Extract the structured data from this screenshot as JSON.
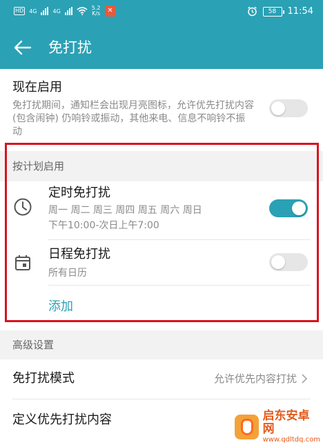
{
  "status_bar": {
    "hd_label": "HD",
    "net1": "4G",
    "net2": "4G",
    "speed_value": "5.2",
    "speed_unit": "K/s",
    "battery": "58",
    "time": "11:54"
  },
  "header": {
    "title": "免打扰"
  },
  "now_enabled": {
    "title": "现在启用",
    "description": "免打扰期间，通知栏会出现月亮图标，允许优先打扰内容 (包含闹钟) 仍响铃或振动，其他来电、信息不响铃不振动",
    "enabled": false
  },
  "schedule_section": {
    "header": "按计划启用",
    "items": [
      {
        "title": "定时免打扰",
        "days": "周一 周二 周三 周四 周五 周六 周日",
        "time_range": "下午10:00-次日上午7:00",
        "enabled": true
      },
      {
        "title": "日程免打扰",
        "subtitle": "所有日历",
        "enabled": false
      }
    ],
    "add_label": "添加"
  },
  "advanced_section": {
    "header": "高级设置",
    "mode_title": "免打扰模式",
    "mode_value": "允许优先内容打扰",
    "priority_title": "定义优先打扰内容"
  },
  "watermark": {
    "name": "启东安卓网",
    "url": "www.qdltdq.com"
  },
  "colors": {
    "accent": "#2ba1b5",
    "highlight": "#d9111c",
    "watermark": "#e55a1c"
  }
}
